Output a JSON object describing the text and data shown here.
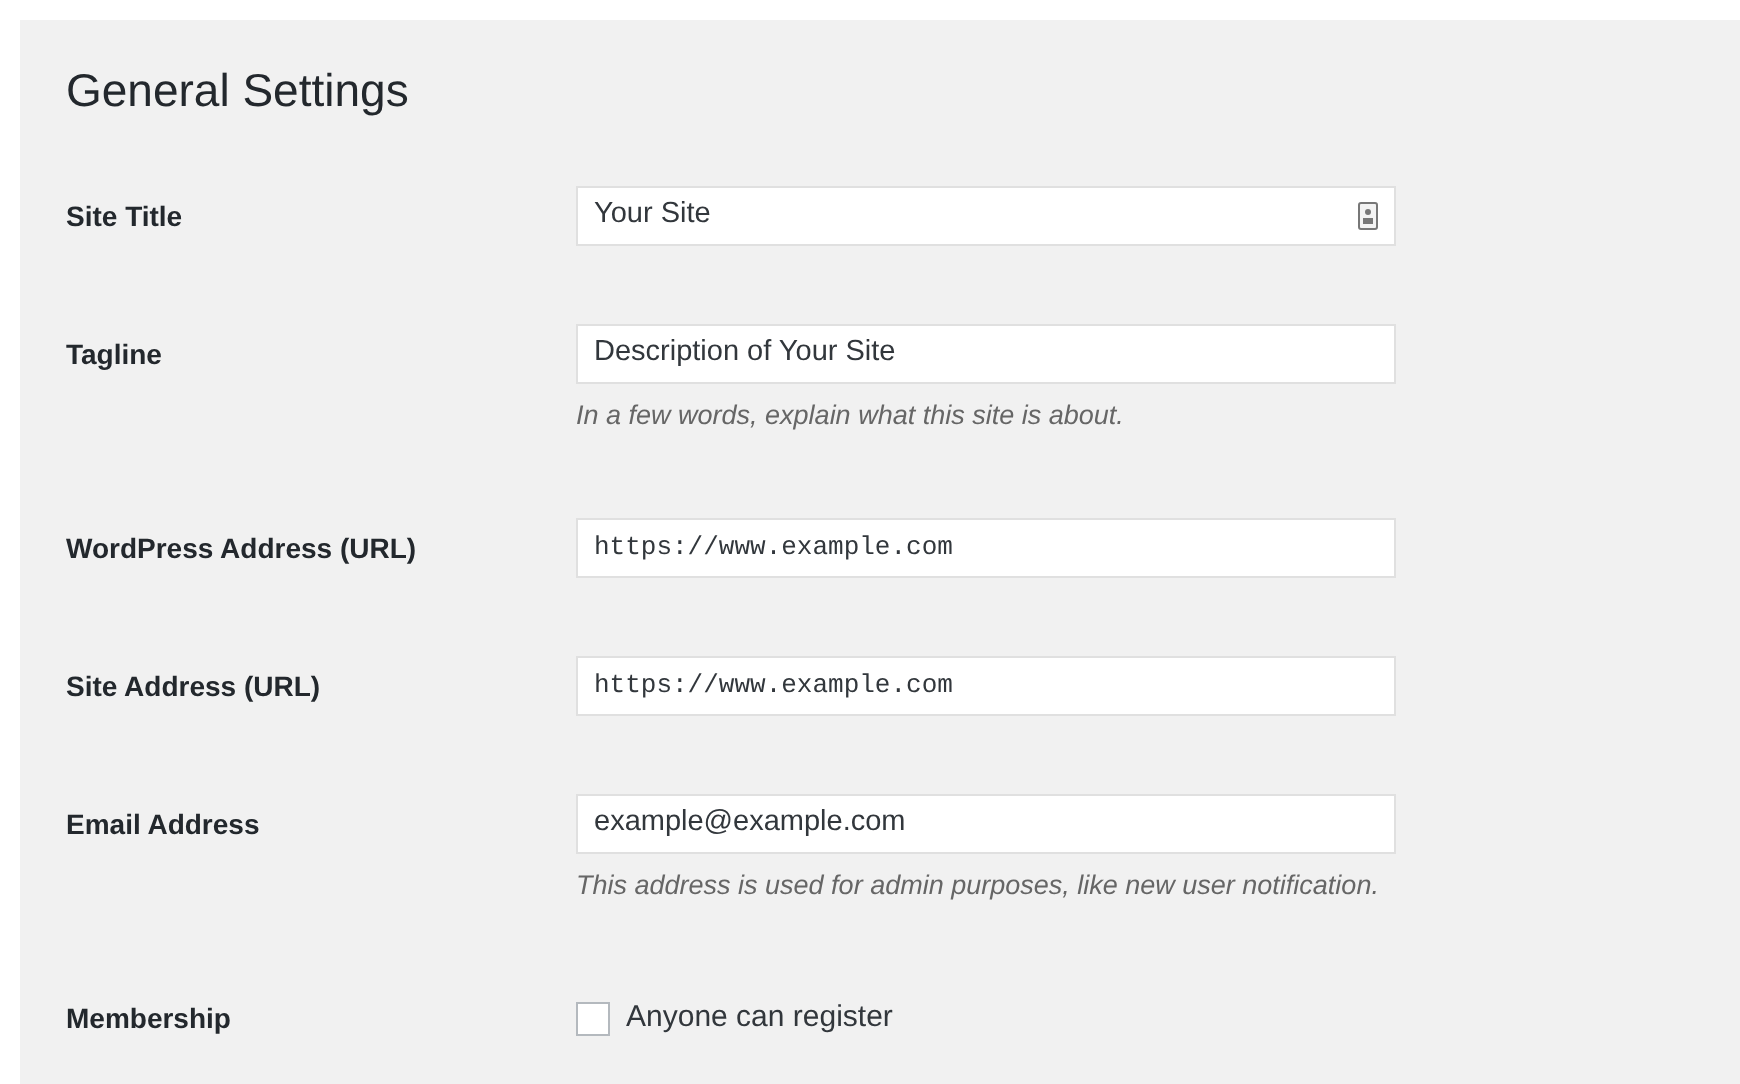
{
  "title": "General Settings",
  "rows": [
    {
      "kind": "text",
      "label": "Site Title",
      "value": "Your Site",
      "trailing_icon": true
    },
    {
      "kind": "text",
      "label": "Tagline",
      "value": "Description of Your Site",
      "trailing_icon": false,
      "description": "In a few words, explain what this site is about."
    },
    {
      "kind": "url",
      "label": "WordPress Address (URL)",
      "value": "https://www.example.com",
      "trailing_icon": false
    },
    {
      "kind": "url",
      "label": "Site Address (URL)",
      "value": "https://www.example.com",
      "trailing_icon": false
    },
    {
      "kind": "text",
      "label": "Email Address",
      "value": "example@example.com",
      "trailing_icon": false,
      "description": "This address is used for admin purposes, like new user notification."
    },
    {
      "kind": "checkbox",
      "label": "Membership",
      "value": "Anyone can register",
      "checked": false
    }
  ]
}
